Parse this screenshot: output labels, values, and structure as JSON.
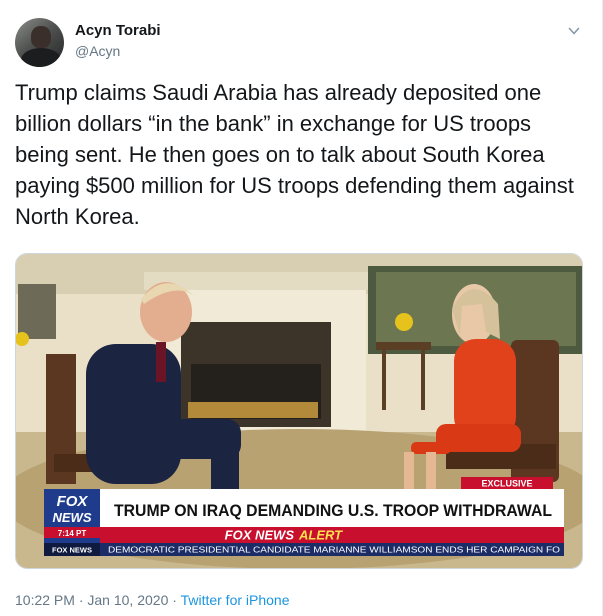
{
  "author": {
    "name": "Acyn Torabi",
    "handle": "@Acyn"
  },
  "tweet": {
    "text": "Trump claims Saudi Arabia has already deposited one billion dollars “in the bank” in exchange for US troops being sent. He then goes on to talk about South Korea paying $500 million for US troops defending them against North Korea.",
    "time": "10:22 PM",
    "separator": "·",
    "date": "Jan 10, 2020",
    "source": "Twitter for iPhone"
  },
  "media": {
    "exclusive_tag": "EXCLUSIVE",
    "network_logo_top": "FOX",
    "network_logo_bottom": "NEWS",
    "clock": "7:14 PT",
    "headline": "TRUMP ON IRAQ DEMANDING U.S. TROOP WITHDRAWAL",
    "alert_label_1": "FOX NEWS",
    "alert_label_2": "ALERT",
    "ticker_logo": "FOX NEWS",
    "ticker_text": "DEMOCRATIC PRESIDENTIAL CANDIDATE MARIANNE WILLIAMSON ENDS HER CAMPAIGN FO"
  },
  "colors": {
    "link": "#1b95e0",
    "secondary_text": "#657786",
    "fox_red": "#c8102e",
    "fox_blue": "#1f3b8c"
  },
  "icons": {
    "caret": "chevron-down-icon"
  }
}
